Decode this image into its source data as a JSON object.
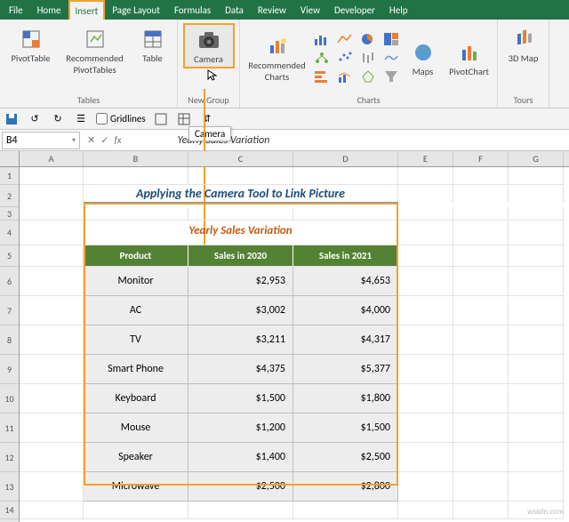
{
  "menu": [
    "File",
    "Home",
    "Insert",
    "Page Layout",
    "Formulas",
    "Data",
    "Review",
    "View",
    "Developer",
    "Help"
  ],
  "menu_selected": "Insert",
  "ribbon": {
    "tables_group": {
      "label": "Tables",
      "items": [
        "PivotTable",
        "Recommended PivotTables",
        "Table"
      ]
    },
    "newgroup": {
      "label": "New Group",
      "item": "Camera"
    },
    "charts_group": {
      "label": "Charts",
      "rec": "Recommended Charts",
      "maps": "Maps",
      "pivotchart": "PivotChart"
    },
    "tours_group": {
      "label": "Tours",
      "item": "3D Map"
    }
  },
  "qat": {
    "gridlines": "Gridlines"
  },
  "tooltip": "Camera",
  "namebox": "B4",
  "formula": "Yearly Sales Variation",
  "cols": [
    "A",
    "B",
    "C",
    "D",
    "E",
    "F",
    "G"
  ],
  "rownums": [
    1,
    2,
    3,
    4,
    5,
    6,
    7,
    8,
    9,
    10,
    11,
    12,
    13,
    14
  ],
  "page_title": "Applying the Camera Tool to Link Picture",
  "table": {
    "title": "Yearly Sales Variation",
    "headers": [
      "Product",
      "Sales in 2020",
      "Sales in 2021"
    ],
    "rows": [
      [
        "Monitor",
        "$2,953",
        "$4,653"
      ],
      [
        "AC",
        "$3,002",
        "$4,000"
      ],
      [
        "TV",
        "$3,211",
        "$4,317"
      ],
      [
        "Smart Phone",
        "$4,375",
        "$5,377"
      ],
      [
        "Keyboard",
        "$1,500",
        "$1,800"
      ],
      [
        "Mouse",
        "$1,200",
        "$1,500"
      ],
      [
        "Speaker",
        "$1,400",
        "$2,500"
      ],
      [
        "Microwave",
        "$2,500",
        "$2,800"
      ]
    ]
  },
  "watermark": "wsxdn.com",
  "chart_data": {
    "type": "table",
    "title": "Yearly Sales Variation",
    "columns": [
      "Product",
      "Sales in 2020",
      "Sales in 2021"
    ],
    "rows": [
      {
        "Product": "Monitor",
        "Sales in 2020": 2953,
        "Sales in 2021": 4653
      },
      {
        "Product": "AC",
        "Sales in 2020": 3002,
        "Sales in 2021": 4000
      },
      {
        "Product": "TV",
        "Sales in 2020": 3211,
        "Sales in 2021": 4317
      },
      {
        "Product": "Smart Phone",
        "Sales in 2020": 4375,
        "Sales in 2021": 5377
      },
      {
        "Product": "Keyboard",
        "Sales in 2020": 1500,
        "Sales in 2021": 1800
      },
      {
        "Product": "Mouse",
        "Sales in 2020": 1200,
        "Sales in 2021": 1500
      },
      {
        "Product": "Speaker",
        "Sales in 2020": 1400,
        "Sales in 2021": 2500
      },
      {
        "Product": "Microwave",
        "Sales in 2020": 2500,
        "Sales in 2021": 2800
      }
    ]
  }
}
